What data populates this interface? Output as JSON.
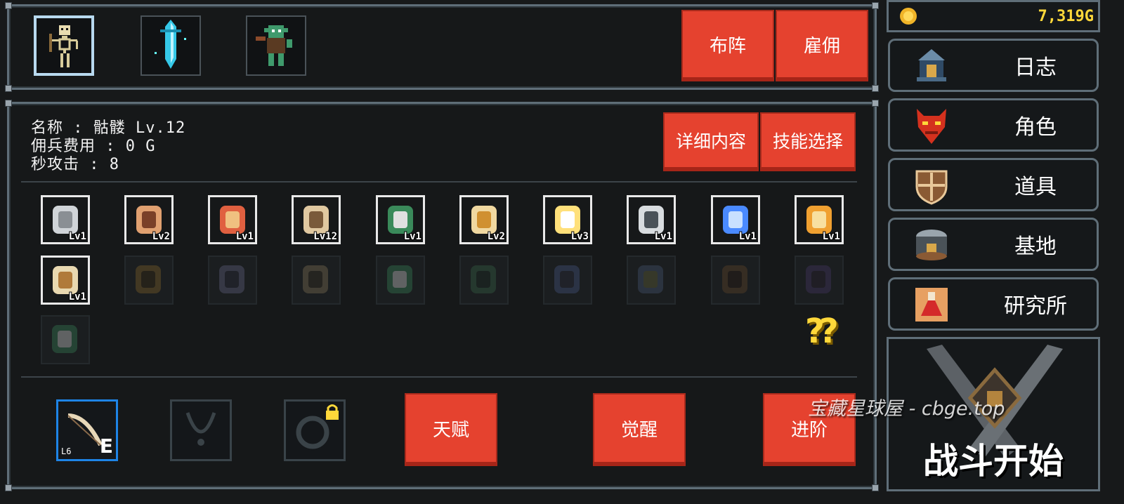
{
  "party": {
    "units": [
      {
        "name": "skeleton-unit",
        "selected": true
      },
      {
        "name": "crystal-sword-unit",
        "selected": false
      },
      {
        "name": "goblin-unit",
        "selected": false
      }
    ],
    "formation_label": "布阵",
    "hire_label": "雇佣"
  },
  "gold": {
    "amount": "7,319G"
  },
  "menu": [
    {
      "id": "log",
      "label": "日志",
      "icon": "lantern-icon"
    },
    {
      "id": "character",
      "label": "角色",
      "icon": "demon-mask-icon"
    },
    {
      "id": "items",
      "label": "道具",
      "icon": "shield-icon"
    },
    {
      "id": "base",
      "label": "基地",
      "icon": "base-icon"
    },
    {
      "id": "lab",
      "label": "研究所",
      "icon": "potion-icon"
    }
  ],
  "battle": {
    "label": "战斗开始",
    "watermark": "宝藏星球屋 - cbge.top"
  },
  "hero": {
    "name_line": "名称 : 骷髅 Lv.12",
    "cost_line": "佣兵费用 : 0 G",
    "dps_line": "秒攻击 : 8",
    "details_label": "详细内容",
    "skill_select_label": "技能选择"
  },
  "skills_unlocked": [
    {
      "icon": "shield-icon",
      "level": "Lv1"
    },
    {
      "icon": "skull-icon",
      "level": "Lv2"
    },
    {
      "icon": "meat-icon",
      "level": "Lv1"
    },
    {
      "icon": "bow-icon",
      "level": "Lv12"
    },
    {
      "icon": "arrows-icon",
      "level": "Lv1"
    },
    {
      "icon": "bomb-icon",
      "level": "Lv2"
    },
    {
      "icon": "arc-icon",
      "level": "Lv3"
    },
    {
      "icon": "shield-rune-icon",
      "level": "Lv1"
    },
    {
      "icon": "frost-bow-icon",
      "level": "Lv1"
    },
    {
      "icon": "fire-arrow-icon",
      "level": "Lv1"
    },
    {
      "icon": "chain-icon",
      "level": "Lv1"
    }
  ],
  "skills_locked": [
    {
      "icon": "up-arrow-icon"
    },
    {
      "icon": "hood-icon"
    },
    {
      "icon": "feather-icon"
    },
    {
      "icon": "arrows-icon"
    },
    {
      "icon": "vine-icon"
    },
    {
      "icon": "crossbow-icon"
    },
    {
      "icon": "star-arrows-icon"
    },
    {
      "icon": "club-icon"
    },
    {
      "icon": "dark-crossbow-icon"
    },
    {
      "icon": "arrows-icon"
    }
  ],
  "help": {
    "label": "??"
  },
  "equipment": [
    {
      "icon": "bow-icon",
      "level": "L6",
      "grade": "E",
      "state": "equipped"
    },
    {
      "icon": "necklace-icon",
      "state": "empty"
    },
    {
      "icon": "ring-icon",
      "state": "locked"
    }
  ],
  "actions": {
    "talent_label": "天赋",
    "awaken_label": "觉醒",
    "advance_label": "进阶"
  },
  "colors": {
    "accent_red": "#e5422f",
    "gold": "#ffd83a",
    "frame": "#5f6e78",
    "selected": "#b8d9ef",
    "equip_selected": "#1e84e6"
  }
}
